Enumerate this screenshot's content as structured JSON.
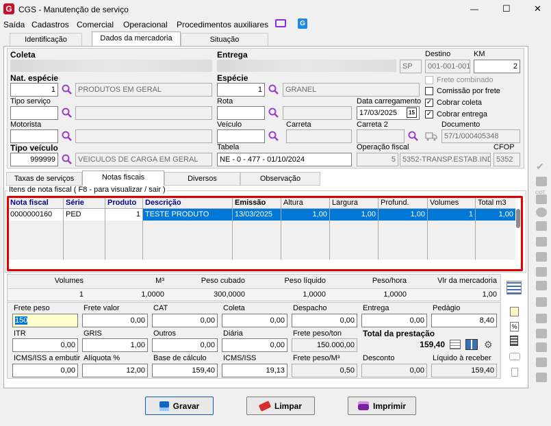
{
  "window": {
    "title": "CGS - Manutenção de serviço",
    "minimize": "—",
    "maximize": "☐",
    "close": "✕"
  },
  "menu": {
    "items": [
      "Saída",
      "Cadastros",
      "Comercial",
      "Operacional",
      "Procedimentos auxiliares"
    ]
  },
  "tabs": {
    "main": [
      "Identificação",
      "Dados da mercadoria",
      "Situação"
    ],
    "lower": [
      "Taxas de serviços",
      "Notas fiscais",
      "Diversos",
      "Observação"
    ]
  },
  "header": {
    "coleta_label": "Coleta",
    "entrega_label": "Entrega",
    "entrega_uf": "SP",
    "destino_label": "Destino",
    "destino": "001-001-001",
    "km_label": "KM",
    "km": "2",
    "nat_especie_label": "Nat. espécie",
    "nat_especie_code": "1",
    "nat_especie_desc": "PRODUTOS EM GERAL",
    "especie_label": "Espécie",
    "especie_code": "1",
    "especie_desc": "GRANEL",
    "frete_combinado": "Frete combinado",
    "comissao_por_frete": "Comissão por frete",
    "cobrar_coleta": "Cobrar coleta",
    "cobrar_entrega": "Cobrar entrega",
    "tipo_servico_label": "Tipo serviço",
    "rota_label": "Rota",
    "data_carregamento_label": "Data carregamento",
    "data_carregamento": "17/03/2025",
    "cal_badge": "15",
    "motorista_label": "Motorista",
    "veiculo_label": "Veículo",
    "carreta_label": "Carreta",
    "carreta2_label": "Carreta 2",
    "documento_label": "Documento",
    "documento": "57/1/000405348",
    "tipo_veiculo_label": "Tipo veículo",
    "tipo_veiculo_code": "999999",
    "tipo_veiculo_desc": "VEICULOS DE CARGA EM GERAL",
    "tabela_label": "Tabela",
    "tabela": "NE - 0 - 477 - 01/10/2024",
    "operacao_fiscal_label": "Operação fiscal",
    "operacao_code": "5",
    "operacao_desc": "5352-TRANSP.ESTAB.IND",
    "cfop_label": "CFOP",
    "cfop": "5352"
  },
  "nf": {
    "group_title": "Itens de nota fiscal ( F8 - para visualizar / sair )",
    "columns": [
      "Nota fiscal",
      "Série",
      "Produto",
      "Descrição",
      "Emissão",
      "Altura",
      "Largura",
      "Profund.",
      "Volumes",
      "Total m3"
    ],
    "rows": [
      [
        "0000000160",
        "PED",
        "1",
        "TESTE PRODUTO",
        "13/03/2025",
        "1,00",
        "1,00",
        "1,00",
        "1",
        "1,00"
      ]
    ],
    "footer_mark": "—"
  },
  "totals": {
    "headers": [
      "Volumes",
      "M³",
      "Peso cubado",
      "Peso líquido",
      "Peso/hora",
      "Vlr da mercadoria"
    ],
    "values": [
      "1",
      "1,0000",
      "300,0000",
      "1,0000",
      "1,0000",
      "1,00"
    ]
  },
  "calc": {
    "frete_peso": {
      "label": "Frete peso",
      "value": "150"
    },
    "frete_valor": {
      "label": "Frete valor",
      "value": "0,00"
    },
    "cat": {
      "label": "CAT",
      "value": "0,00"
    },
    "coleta": {
      "label": "Coleta",
      "value": "0,00"
    },
    "despacho": {
      "label": "Despacho",
      "value": "0,00"
    },
    "entrega": {
      "label": "Entrega",
      "value": "0,00"
    },
    "pedagio": {
      "label": "Pedágio",
      "value": "8,40"
    },
    "itr": {
      "label": "ITR",
      "value": "0,00"
    },
    "gris": {
      "label": "GRIS",
      "value": "1,00"
    },
    "outros": {
      "label": "Outros",
      "value": "0,00"
    },
    "diaria": {
      "label": "Diária",
      "value": "0,00"
    },
    "frete_peso_ton": {
      "label": "Frete peso/ton",
      "value": "150.000,00"
    },
    "total_prestacao": {
      "label": "Total da prestação",
      "value": "159,40"
    },
    "icms_embutir": {
      "label": "ICMS/ISS a embutir",
      "value": "0,00"
    },
    "aliquota": {
      "label": "Alíquota %",
      "value": "12,00"
    },
    "base_calculo": {
      "label": "Base de cálculo",
      "value": "159,40"
    },
    "icms_iss": {
      "label": "ICMS/ISS",
      "value": "19,13"
    },
    "frete_peso_m3": {
      "label": "Frete peso/M³",
      "value": "0,50"
    },
    "desconto": {
      "label": "Desconto",
      "value": "0,00"
    },
    "liquido_receber": {
      "label": "Líquido à receber",
      "value": "159,40"
    }
  },
  "buttons": {
    "gravar": "Gravar",
    "limpar": "Limpar",
    "imprimir": "Imprimir"
  },
  "side_icon_label": "CIOT",
  "colors": {
    "accent": "#0a5fb4",
    "selection": "#0078d7",
    "highlight_border": "#e00000",
    "app_logo": "#c8102e",
    "magnifier": "#9b3fc9"
  }
}
